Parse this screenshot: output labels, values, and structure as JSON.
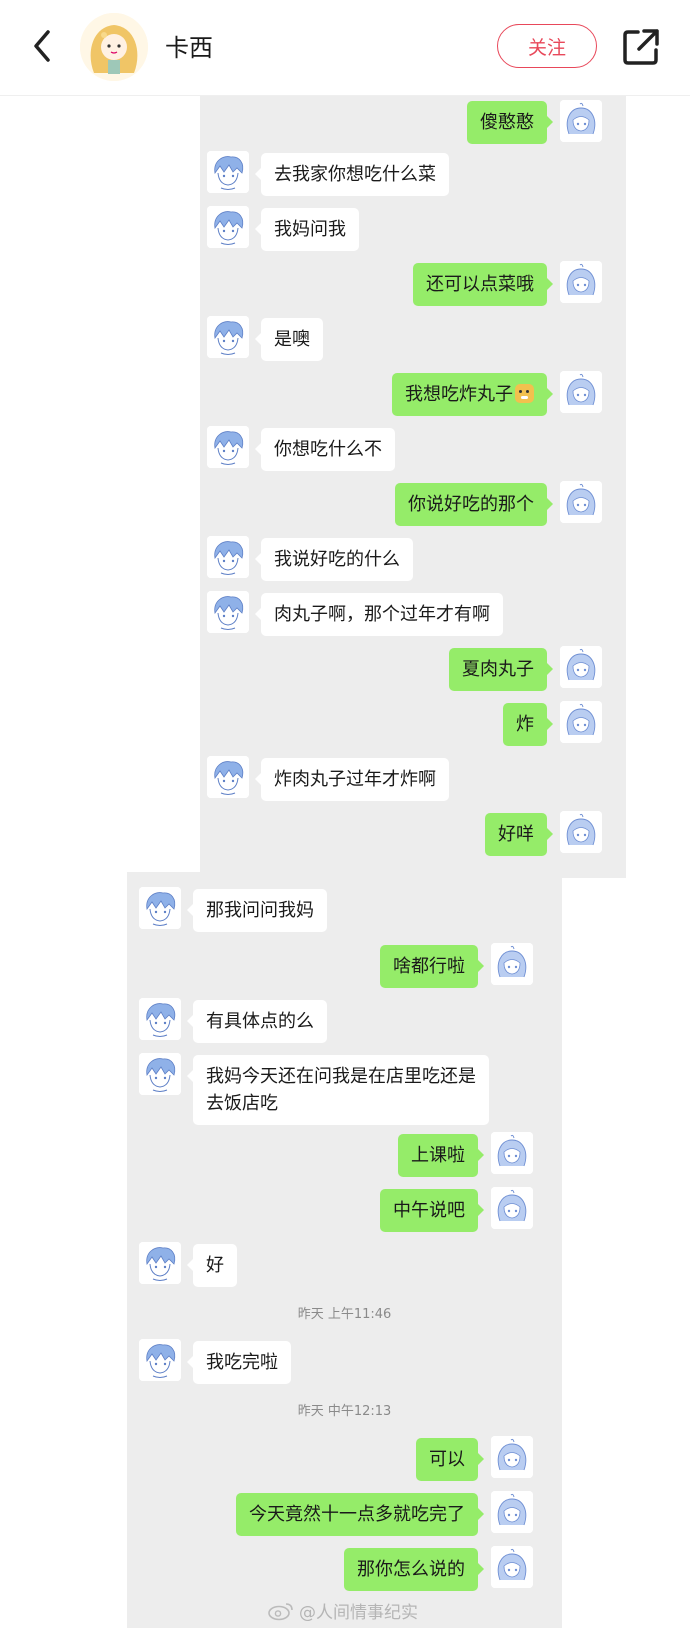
{
  "header": {
    "back_icon": "chevron-left-icon",
    "name": "卡西",
    "follow_label": "关注",
    "share_icon": "share-out-icon",
    "accent_color": "#e8485a"
  },
  "colors": {
    "sent_bubble": "#95ec69",
    "received_bubble": "#ffffff",
    "chat_background": "#ededed"
  },
  "chat_panel_1": {
    "messages": [
      {
        "from": "me",
        "text": "傻憨憨"
      },
      {
        "from": "other",
        "text": "去我家你想吃什么菜"
      },
      {
        "from": "other",
        "text": "我妈问我"
      },
      {
        "from": "me",
        "text": "还可以点菜哦"
      },
      {
        "from": "other",
        "text": "是噢"
      },
      {
        "from": "me",
        "text": "我想吃炸丸子",
        "emoji": "doge-emoji"
      },
      {
        "from": "other",
        "text": "你想吃什么不"
      },
      {
        "from": "me",
        "text": "你说好吃的那个"
      },
      {
        "from": "other",
        "text": "我说好吃的什么"
      },
      {
        "from": "other",
        "text": "肉丸子啊，那个过年才有啊"
      },
      {
        "from": "me",
        "text": "夏肉丸子"
      },
      {
        "from": "me",
        "text": "炸"
      },
      {
        "from": "other",
        "text": "炸肉丸子过年才炸啊"
      },
      {
        "from": "me",
        "text": "好咩"
      }
    ]
  },
  "chat_panel_2": {
    "messages": [
      {
        "from": "other",
        "text": "那我问问我妈"
      },
      {
        "from": "me",
        "text": "啥都行啦"
      },
      {
        "from": "other",
        "text": "有具体点的么"
      },
      {
        "from": "other",
        "text": "我妈今天还在问我是在店里吃还是去饭店吃"
      },
      {
        "from": "me",
        "text": "上课啦"
      },
      {
        "from": "me",
        "text": "中午说吧"
      },
      {
        "from": "other",
        "text": "好"
      },
      {
        "timestamp": "昨天 上午11:46"
      },
      {
        "from": "other",
        "text": "我吃完啦"
      },
      {
        "timestamp": "昨天 中午12:13"
      },
      {
        "from": "me",
        "text": "可以"
      },
      {
        "from": "me",
        "text": "今天竟然十一点多就吃完了"
      },
      {
        "from": "me",
        "text": "那你怎么说的"
      }
    ]
  },
  "watermark": {
    "icon": "weibo-icon",
    "text": "@人间情事纪实"
  }
}
